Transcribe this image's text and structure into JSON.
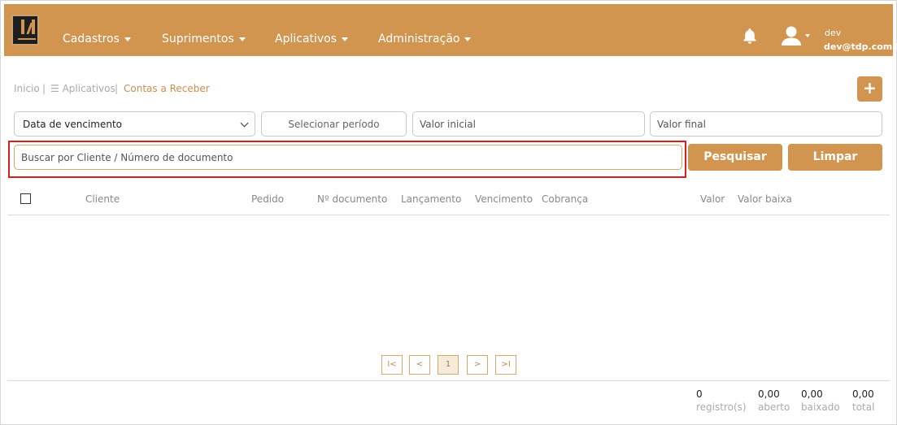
{
  "header": {
    "nav": [
      {
        "label": "Cadastros"
      },
      {
        "label": "Suprimentos"
      },
      {
        "label": "Aplicativos"
      },
      {
        "label": "Administração"
      }
    ],
    "user": {
      "name": "dev",
      "email": "dev@tdp.com.br"
    },
    "colors": {
      "brand": "#d19550"
    }
  },
  "breadcrumb": {
    "home": "Inicio",
    "sep": "|",
    "apps": "☰ Aplicativos",
    "current": "Contas a Receber"
  },
  "actions": {
    "add_label": "+"
  },
  "filters": {
    "date_select": "Data de vencimento",
    "periodo_placeholder": "Selecionar período",
    "valor_inicial_placeholder": "Valor inicial",
    "valor_final_placeholder": "Valor final",
    "search_placeholder": "Buscar por Cliente / Número de documento",
    "search_button": "Pesquisar",
    "clear_button": "Limpar"
  },
  "table": {
    "columns": [
      "Cliente",
      "Pedido",
      "Nº documento",
      "Lançamento",
      "Vencimento",
      "Cobrança",
      "Valor",
      "Valor baixa"
    ],
    "rows": []
  },
  "pagination": {
    "first": "I<",
    "prev": "<",
    "current": "1",
    "next": ">",
    "last": ">I"
  },
  "summary": [
    {
      "value": "0",
      "label": "registro(s)"
    },
    {
      "value": "0,00",
      "label": "aberto"
    },
    {
      "value": "0,00",
      "label": "baixado"
    },
    {
      "value": "0,00",
      "label": "total"
    }
  ]
}
